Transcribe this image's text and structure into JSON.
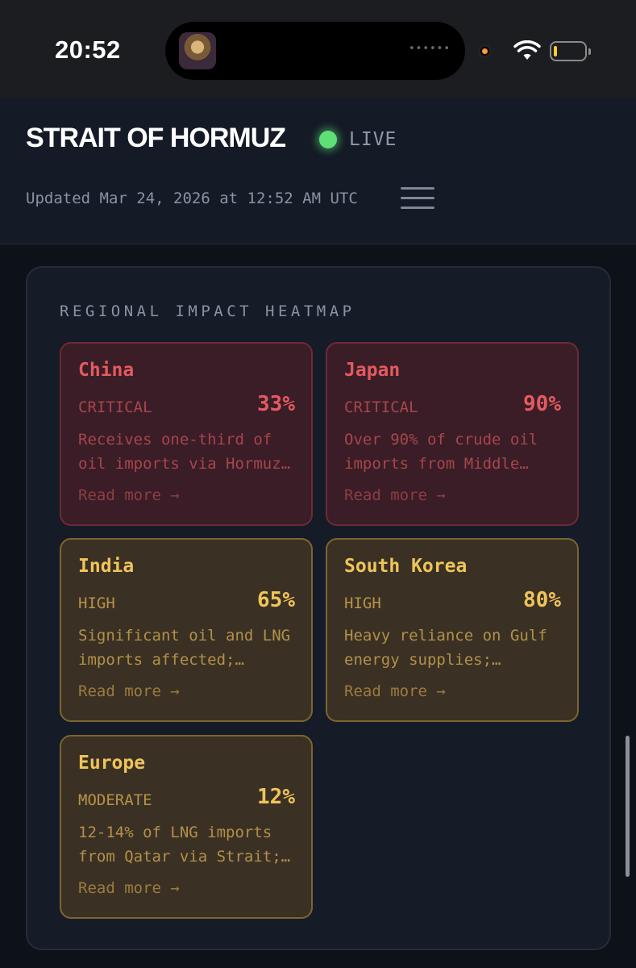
{
  "status_bar": {
    "time": "20:52",
    "island_dots": "••••••"
  },
  "header": {
    "title": "STRAIT OF HORMUZ",
    "live_label": "LIVE",
    "updated": "Updated Mar 24, 2026 at 12:52 AM UTC"
  },
  "heatmap": {
    "title": "REGIONAL IMPACT HEATMAP",
    "cards": [
      {
        "name": "China",
        "level": "CRITICAL",
        "percent": "33%",
        "desc_line1": "Receives one-third of",
        "desc_line2": "oil imports via Hormuz…",
        "link": "Read more →"
      },
      {
        "name": "Japan",
        "level": "CRITICAL",
        "percent": "90%",
        "desc_line1": "Over 90% of crude oil",
        "desc_line2": "imports from Middle…",
        "link": "Read more →"
      },
      {
        "name": "India",
        "level": "HIGH",
        "percent": "65%",
        "desc_line1": "Significant oil and LNG",
        "desc_line2": "imports affected;…",
        "link": "Read more →"
      },
      {
        "name": "South Korea",
        "level": "HIGH",
        "percent": "80%",
        "desc_line1": "Heavy reliance on Gulf",
        "desc_line2": "energy supplies;…",
        "link": "Read more →"
      },
      {
        "name": "Europe",
        "level": "MODERATE",
        "percent": "12%",
        "desc_line1": "12-14% of LNG imports",
        "desc_line2": "from Qatar via Strait;…",
        "link": "Read more →"
      }
    ]
  },
  "icons": {
    "live": "status-dot-icon",
    "menu": "hamburger-menu-icon",
    "wifi": "wifi-icon",
    "battery": "battery-icon"
  },
  "colors": {
    "critical": "#e45a60",
    "high": "#f0c45a",
    "live": "#5ee076",
    "background": "#0d1118"
  }
}
